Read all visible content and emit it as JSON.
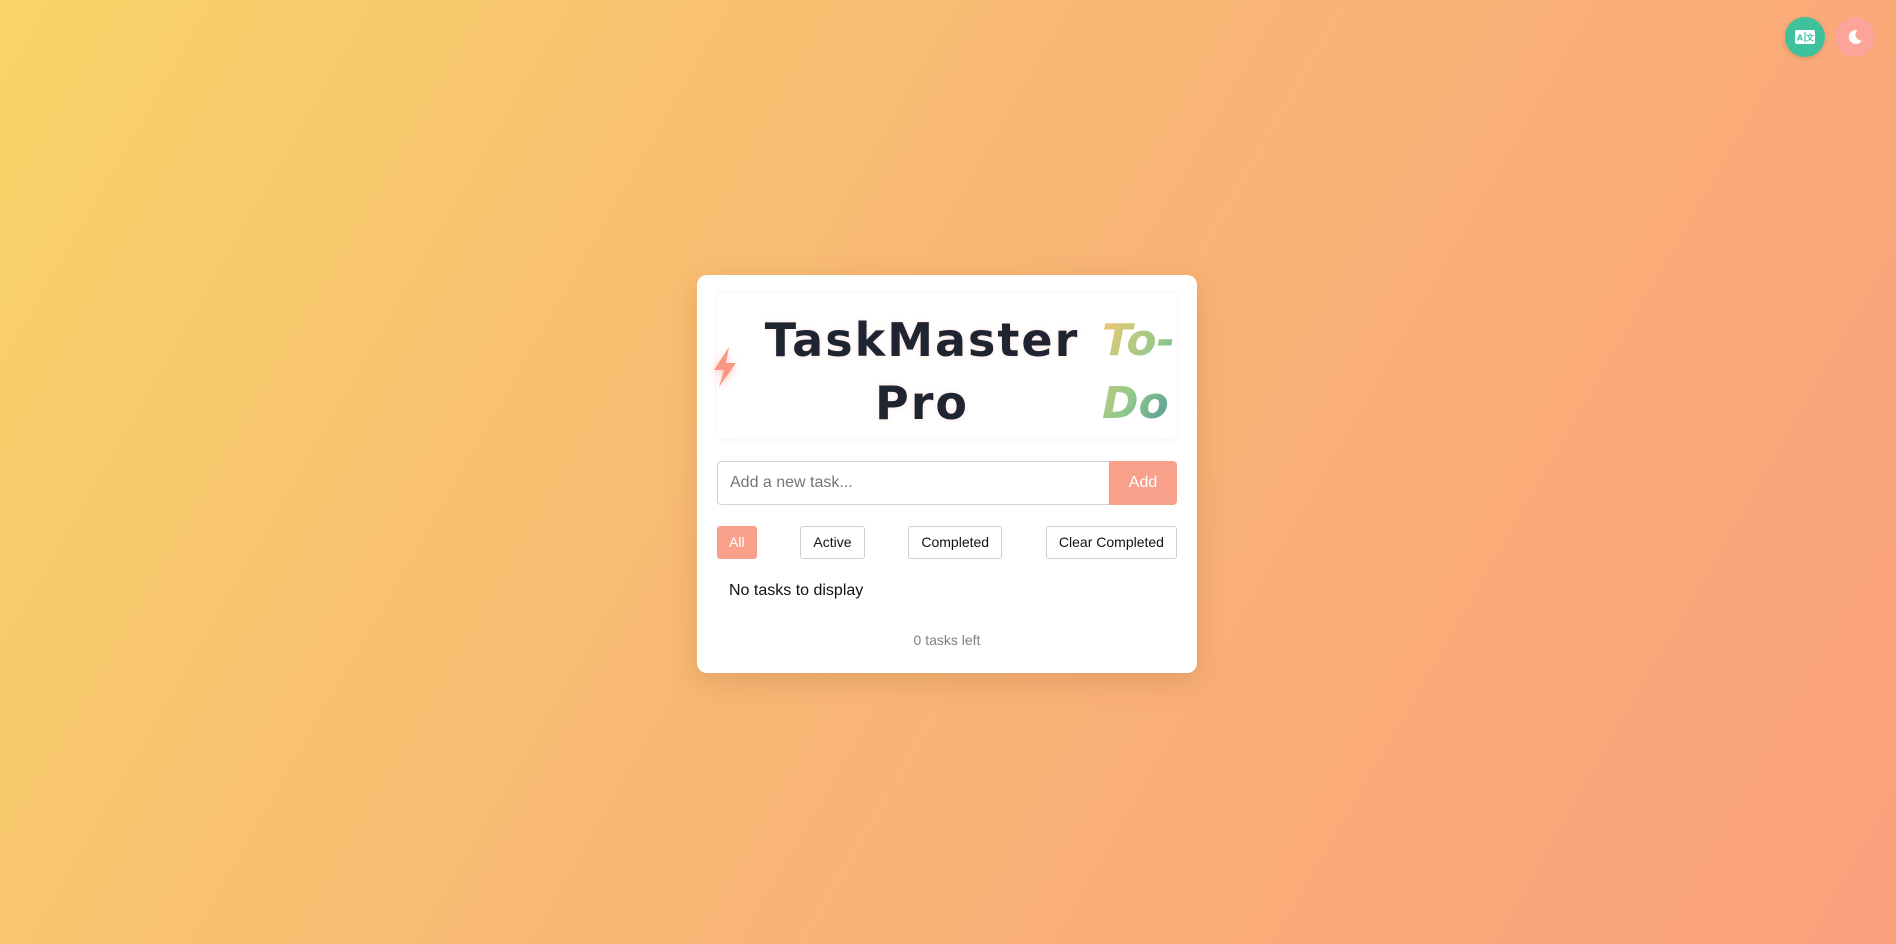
{
  "app": {
    "title_line1": "TaskMaster",
    "title_line2": "Pro",
    "tag": "To-Do"
  },
  "corner": {
    "language_icon": "language-card-icon",
    "theme_icon": "moon-icon"
  },
  "input": {
    "placeholder": "Add a new task...",
    "value": "",
    "add_label": "Add"
  },
  "filters": {
    "all": "All",
    "active": "Active",
    "completed": "Completed",
    "clear_completed": "Clear Completed",
    "selected": "All"
  },
  "list": {
    "empty_message": "No tasks to display"
  },
  "footer": {
    "count_text": "0 tasks left"
  },
  "colors": {
    "accent": "#f9a08a",
    "language_button": "#3ec19c",
    "theme_button": "#fca49a",
    "title_text": "#1f2530"
  }
}
